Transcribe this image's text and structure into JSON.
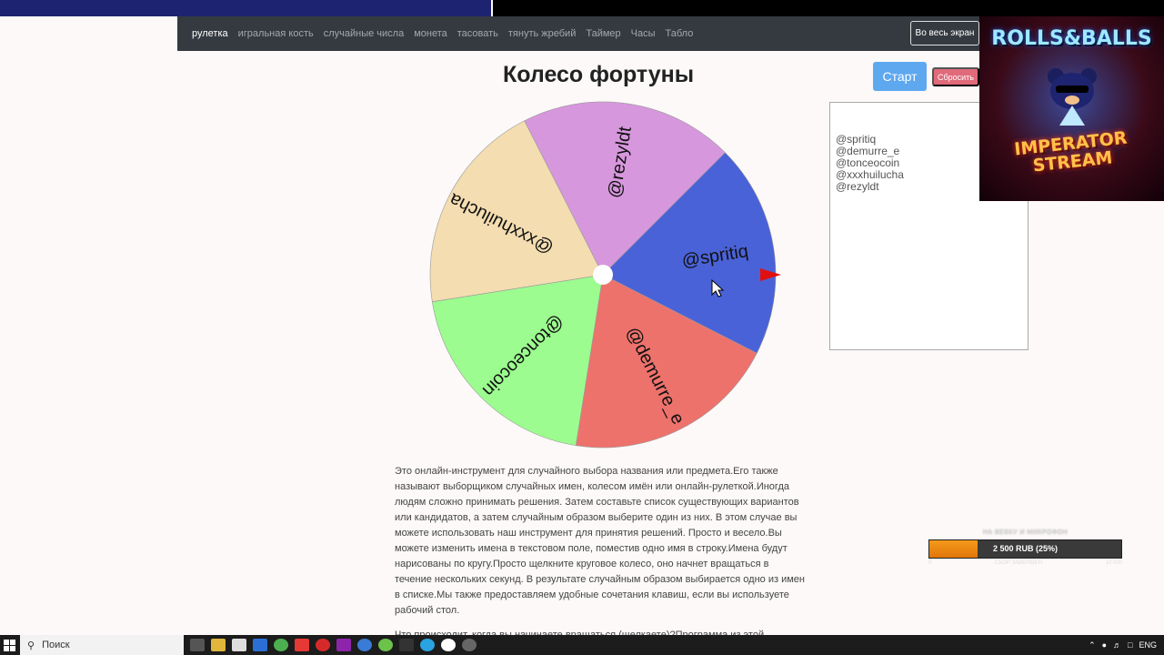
{
  "nav": {
    "items": [
      "рулетка",
      "игральная кость",
      "случайные числа",
      "монета",
      "тасовать",
      "тянуть жребий",
      "Таймер",
      "Часы",
      "Табло"
    ],
    "fullscreen_label": "Во весь экран"
  },
  "main": {
    "title": "Колесо фортуны",
    "start_label": "Старт",
    "reset_label": "Сбросить"
  },
  "names": [
    "@spritiq",
    "@demurre_e",
    "@tonceocoin",
    "@xxxhuilucha",
    "@rezyldt"
  ],
  "wheel": {
    "segments": [
      {
        "label": "@spritiq",
        "color": "#4a62d8"
      },
      {
        "label": "@demurre_e",
        "color": "#ee726c"
      },
      {
        "label": "@tonceocoin",
        "color": "#9cfc8f"
      },
      {
        "label": "@xxxhuilucha",
        "color": "#f3ddb1"
      },
      {
        "label": "@rezyldt",
        "color": "#d797dd"
      }
    ],
    "pointer_color": "#e01010"
  },
  "description": "Это онлайн-инструмент для случайного выбора названия или предмета.Его также называют выборщиком случайных имен, колесом имён или онлайн-рулеткой.Иногда людям сложно принимать решения. Затем составьте список существующих вариантов или кандидатов, а затем случайным образом выберите один из них. В этом случае вы можете использовать наш инструмент для принятия решений. Просто и весело.Вы можете изменить имена в текстовом поле, поместив одно имя в строку.Имена будут нарисованы по кругу.Просто щелкните круговое колесо, оно начнет вращаться в течение нескольких секунд. В результате случайным образом выбирается одно из имен в списке.Мы также предоставляем удобные сочетания клавиш, если вы используете рабочий стол.",
  "description_2": "Что происходит, когда вы начинаете вращаться (щелкаете)?Программа из этой",
  "overlay": {
    "title_top": "ROLLS&BALLS",
    "title_bottom_1": "IMPERATOR",
    "title_bottom_2": "STREAM"
  },
  "donation": {
    "goal_label": "НА ВЕБКУ И МИКРОФОН",
    "amount_text": "2 500 RUB (25%)",
    "progress": 0.25,
    "scale_min": "0",
    "scale_mid": "СБОР ЗАВЕРШЕН",
    "scale_max": "10 000"
  },
  "taskbar": {
    "search_label": "Поиск",
    "lang": "ENG"
  }
}
